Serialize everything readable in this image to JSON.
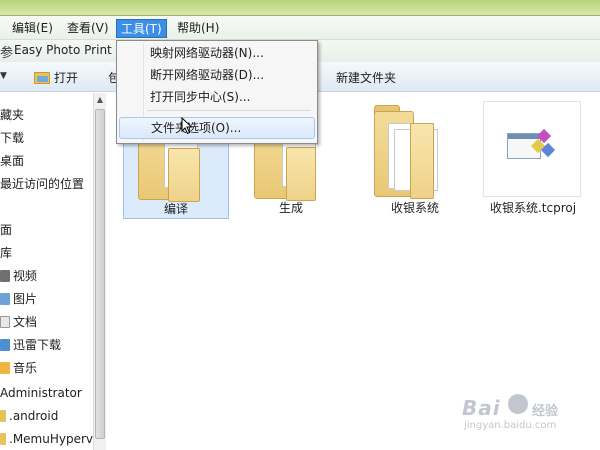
{
  "menubar": {
    "items": [
      "编辑(E)",
      "查看(V)",
      "工具(T)",
      "帮助(H)"
    ]
  },
  "app_row": {
    "glyph": "参",
    "title": "Easy Photo Print"
  },
  "toolbar": {
    "open_label": "打开",
    "partial_label": "包",
    "new_folder_label": "新建文件夹"
  },
  "sidebar": {
    "items": [
      "藏夹",
      "下载",
      "桌面",
      "最近访问的位置",
      "面",
      "库",
      "视频",
      "图片",
      "文档",
      "迅雷下载",
      "音乐",
      "Administrator",
      ".android",
      ".MemuHyperv"
    ]
  },
  "tools_menu": {
    "items": [
      "映射网络驱动器(N)...",
      "断开网络驱动器(D)...",
      "打开同步中心(S)...",
      "文件夹选项(O)..."
    ],
    "hovered_item": "文件夹选项(O)..."
  },
  "files": [
    {
      "name": "编译",
      "type": "folder",
      "selected": true
    },
    {
      "name": "生成",
      "type": "folder",
      "selected": false
    },
    {
      "name": "收银系统",
      "type": "folder",
      "selected": false
    },
    {
      "name": "收银系统.tcproj",
      "type": "tcproj",
      "selected": false
    }
  ],
  "watermark": {
    "logo": "Bai",
    "logo_suffix": "经验",
    "url": "jingyan.baidu.com"
  },
  "colors": {
    "menu_active": "#3d8ee6",
    "selection": "#dcebfb",
    "folder": "#f3dc9a"
  }
}
